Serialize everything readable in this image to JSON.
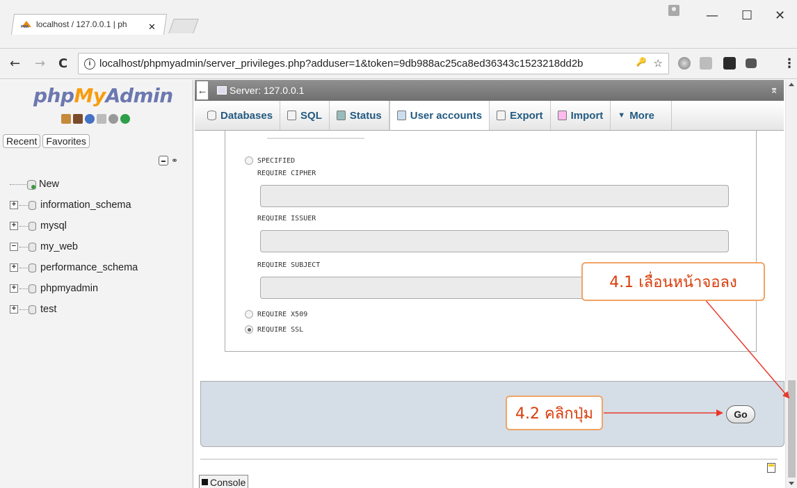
{
  "browser": {
    "tab_title": "localhost / 127.0.0.1 | ph",
    "tab_close": "✕",
    "window_minimize": "—",
    "window_maximize": "☐",
    "window_close": "✕",
    "back": "←",
    "forward": "→",
    "reload": "C",
    "info_icon": "i",
    "url": "localhost/phpmyadmin/server_privileges.php?adduser=1&token=9db988ac25ca8ed36343c1523218dd2b",
    "key_icon": "🔑",
    "star_icon": "☆",
    "menu_icon": "⋮"
  },
  "sidebar": {
    "logo_php": "php",
    "logo_my": "My",
    "logo_admin": "Admin",
    "recent_label": "Recent",
    "favorites_label": "Favorites",
    "link_icon": "⚭",
    "tree": [
      {
        "label": "New",
        "type": "new"
      },
      {
        "label": "information_schema",
        "expander": "+"
      },
      {
        "label": "mysql",
        "expander": "+"
      },
      {
        "label": "my_web",
        "expander": "−"
      },
      {
        "label": "performance_schema",
        "expander": "+"
      },
      {
        "label": "phpmyadmin",
        "expander": "+"
      },
      {
        "label": "test",
        "expander": "+"
      }
    ]
  },
  "server_bar": {
    "back_arrow": "←",
    "title": "Server: 127.0.0.1",
    "collapse": "⌆"
  },
  "topmenu": {
    "items": [
      "Databases",
      "SQL",
      "Status",
      "User accounts",
      "Export",
      "Import",
      "More"
    ],
    "more_arrow": "▼"
  },
  "ssl": {
    "specified": "SPECIFIED",
    "require_cipher": "REQUIRE CIPHER",
    "require_issuer": "REQUIRE ISSUER",
    "require_subject": "REQUIRE SUBJECT",
    "require_x509": "REQUIRE X509",
    "require_ssl": "REQUIRE SSL",
    "selected": "REQUIRE SSL"
  },
  "go_button": "Go",
  "console_label": "Console",
  "annotations": {
    "step1": "4.1 เลื่อนหน้าจอลง",
    "step2": "4.2 คลิกปุ่ม",
    "color": "#e8382c"
  }
}
